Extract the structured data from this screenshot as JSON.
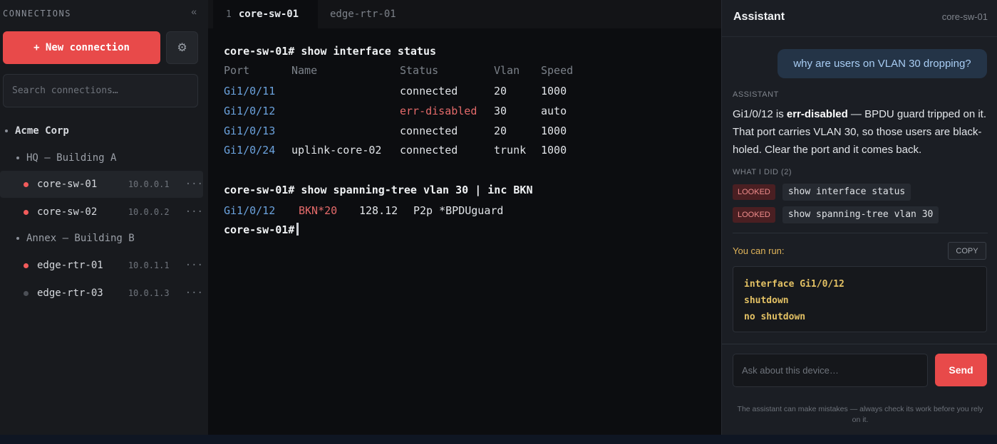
{
  "sidebar": {
    "title": "CONNECTIONS",
    "collapse_icon": "«",
    "new_connection_label": "+ New connection",
    "settings_icon": "⚙",
    "search_placeholder": "Search connections…",
    "org": "Acme Corp",
    "sites": [
      {
        "name": "HQ — Building A"
      },
      {
        "name": "Annex — Building B"
      }
    ],
    "devices": [
      {
        "name": "core-sw-01",
        "ip": "10.0.0.1",
        "more": "···",
        "status_color": "#f25b5b"
      },
      {
        "name": "core-sw-02",
        "ip": "10.0.0.2",
        "more": "···",
        "status_color": "#f25b5b"
      },
      {
        "name": "edge-rtr-01",
        "ip": "10.0.1.1",
        "more": "···",
        "status_color": "#f25b5b"
      },
      {
        "name": "edge-rtr-03",
        "ip": "10.0.1.3",
        "more": "···",
        "status_color": "#4b4f56"
      }
    ]
  },
  "terminal": {
    "tabs": [
      {
        "num": "1",
        "label": "core-sw-01"
      },
      {
        "label": "edge-rtr-01"
      }
    ],
    "prompt": "core-sw-01#",
    "cmd1": "show interface status",
    "header": {
      "port": "Port",
      "name": "Name",
      "status": "Status",
      "vlan": "Vlan",
      "speed": "Speed"
    },
    "rows": [
      {
        "port": "Gi1/0/11",
        "name": "",
        "status": "connected",
        "vlan": "20",
        "speed": "1000"
      },
      {
        "port": "Gi1/0/12",
        "name": "",
        "status": "err-disabled",
        "vlan": "30",
        "speed": "auto"
      },
      {
        "port": "Gi1/0/13",
        "name": "",
        "status": "connected",
        "vlan": "20",
        "speed": "1000"
      },
      {
        "port": "Gi1/0/24",
        "name": "uplink-core-02",
        "status": "connected",
        "vlan": "trunk",
        "speed": "1000"
      }
    ],
    "cmd2": "show spanning-tree vlan 30 | inc BKN",
    "stp": {
      "port": "Gi1/0/12",
      "role": "BKN*20",
      "prio": "128.12",
      "type": "P2p *BPDUguard"
    }
  },
  "assistant": {
    "title": "Assistant",
    "device": "core-sw-01",
    "user_message": "why are users on VLAN 30 dropping?",
    "reply_label": "ASSISTANT",
    "reply_pre": "Gi1/0/12 is ",
    "reply_bold": "err-disabled",
    "reply_post": " — BPDU guard tripped on it. That port carries VLAN 30, so those users are black-holed. Clear the port and it comes back.",
    "actions_label": "WHAT I DID (2)",
    "actions": [
      {
        "badge": "LOOKED",
        "command": "show interface status"
      },
      {
        "badge": "LOOKED",
        "command": "show spanning-tree vlan 30"
      }
    ],
    "can_run_label": "You can run:",
    "copy_label": "COPY",
    "code_lines": [
      "interface Gi1/0/12",
      "shutdown",
      "no shutdown"
    ],
    "input_placeholder": "Ask about this device…",
    "send_label": "Send",
    "disclaimer": "The assistant can make mistakes — always check its work before you rely on it."
  }
}
